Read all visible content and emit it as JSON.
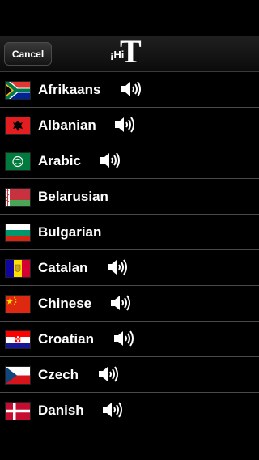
{
  "navbar": {
    "cancel_label": "Cancel",
    "logo_small": "¡Hi",
    "logo_big": "T"
  },
  "languages": [
    {
      "name": "Afrikaans",
      "flag": "south-africa",
      "audio": true
    },
    {
      "name": "Albanian",
      "flag": "albania",
      "audio": true
    },
    {
      "name": "Arabic",
      "flag": "arab-league",
      "audio": true
    },
    {
      "name": "Belarusian",
      "flag": "belarus",
      "audio": false
    },
    {
      "name": "Bulgarian",
      "flag": "bulgaria",
      "audio": false
    },
    {
      "name": "Catalan",
      "flag": "andorra",
      "audio": true
    },
    {
      "name": "Chinese",
      "flag": "china",
      "audio": true
    },
    {
      "name": "Croatian",
      "flag": "croatia",
      "audio": true
    },
    {
      "name": "Czech",
      "flag": "czech-republic",
      "audio": true
    },
    {
      "name": "Danish",
      "flag": "denmark",
      "audio": true
    }
  ]
}
